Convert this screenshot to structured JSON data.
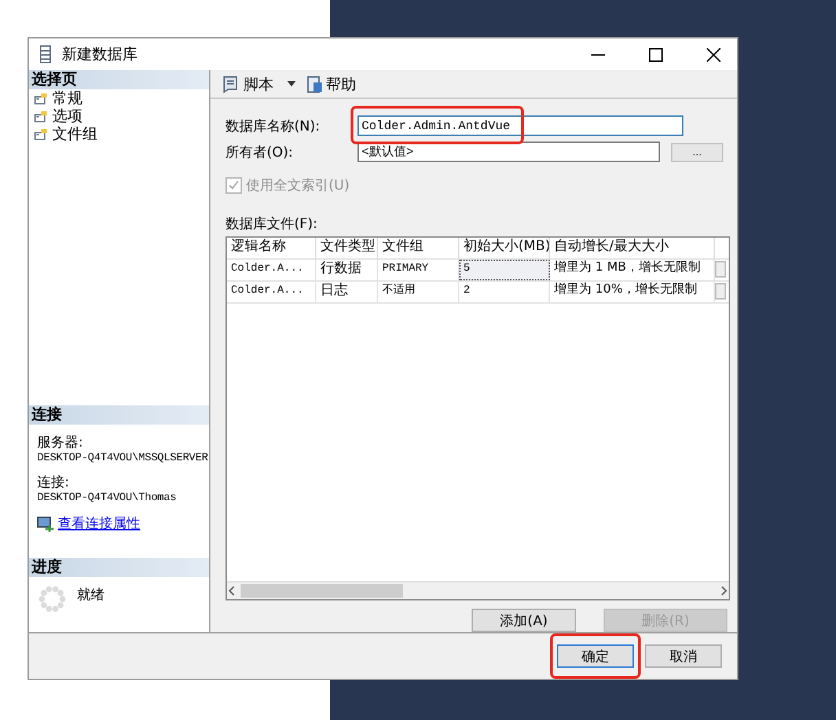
{
  "window": {
    "title": "新建数据库"
  },
  "sidebar": {
    "pages_header": "选择页",
    "pages": [
      {
        "label": "常规"
      },
      {
        "label": "选项"
      },
      {
        "label": "文件组"
      }
    ],
    "connection_header": "连接",
    "server_label": "服务器:",
    "server": "DESKTOP-Q4T4VOU\\MSSQLSERVER",
    "connection_label": "连接:",
    "connection": "DESKTOP-Q4T4VOU\\Thomas",
    "link": "查看连接属性",
    "progress_header": "进度",
    "status": "就绪"
  },
  "toolbar": [
    {
      "label": "脚本",
      "kind": "dropdown"
    },
    {
      "label": "帮助",
      "kind": "help"
    }
  ],
  "form": {
    "name_label": "数据库名称(N):",
    "name_value": "Colder.Admin.AntdVue",
    "name_highlighted": true,
    "owner_label": "所有者(O):",
    "owner_value": "<默认值>",
    "browse": "...",
    "fulltext": {
      "label": "使用全文索引(U)",
      "checked": true,
      "disabled": true
    }
  },
  "files": {
    "label": "数据库文件(F):",
    "columns": [
      "逻辑名称",
      "文件类型",
      "文件组",
      "初始大小(MB)",
      "自动增长/最大大小"
    ],
    "rows": [
      {
        "cells": [
          {
            "text": "Colder.A...",
            "focused": false
          },
          {
            "text": "行数据",
            "focused": false
          },
          {
            "text": "PRIMARY",
            "focused": false
          },
          {
            "text": "5",
            "focused": true
          },
          {
            "text": "增里为 1 MB，增长无限制",
            "focused": false
          }
        ]
      },
      {
        "cells": [
          {
            "text": "Colder.A...",
            "focused": false
          },
          {
            "text": "日志",
            "focused": false
          },
          {
            "text": "不适用",
            "focused": false
          },
          {
            "text": "2",
            "focused": false
          },
          {
            "text": "增里为 10%，增长无限制",
            "focused": false
          }
        ]
      }
    ]
  },
  "file_buttons": [
    {
      "label": "添加(A)",
      "disabled": false
    },
    {
      "label": "删除(R)",
      "disabled": true
    }
  ],
  "footer_buttons": [
    {
      "label": "确定",
      "default": true,
      "highlighted": true
    },
    {
      "label": "取消",
      "default": false,
      "highlighted": false
    }
  ]
}
